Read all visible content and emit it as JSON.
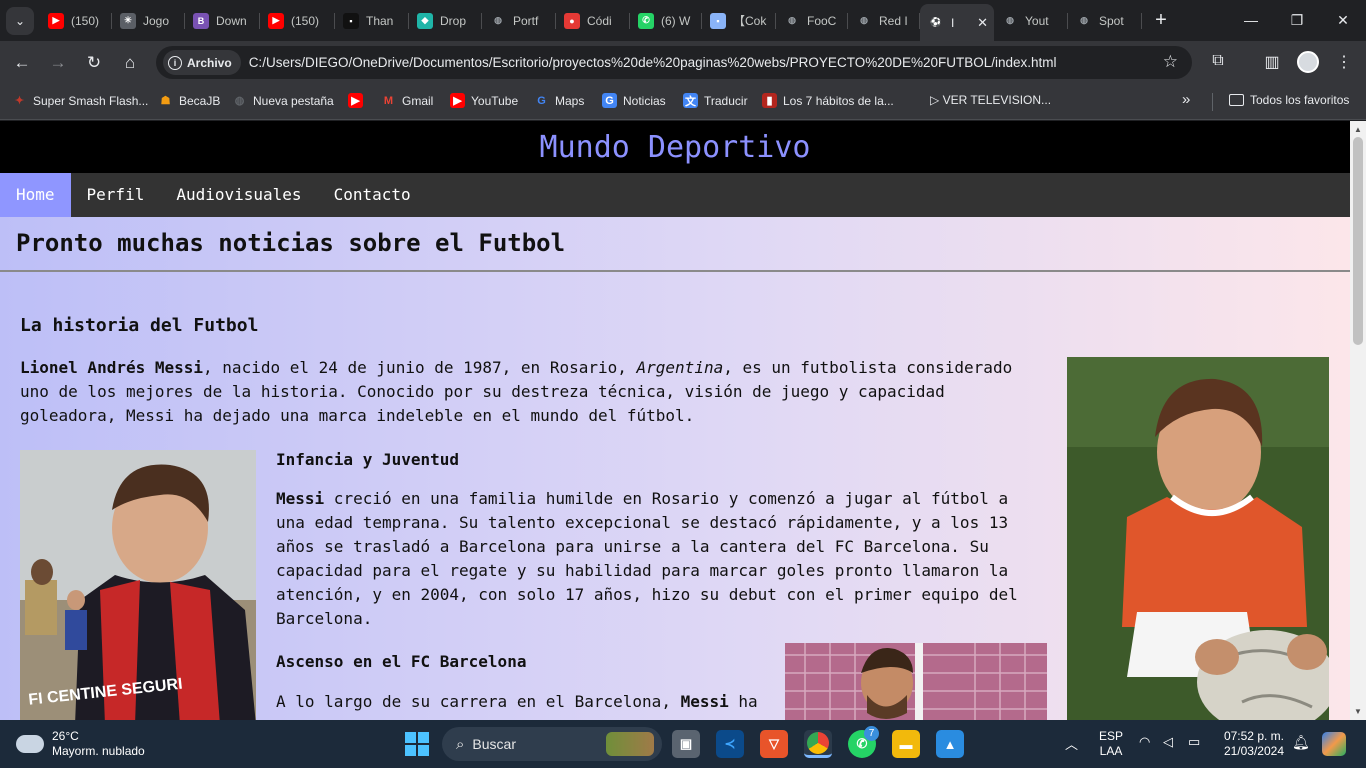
{
  "browser": {
    "tabs": [
      {
        "label": "(150)",
        "icon": "youtube-icon",
        "color": "#ff0000"
      },
      {
        "label": "Jogo",
        "icon": "chatgpt-icon",
        "color": "#5b5f66"
      },
      {
        "label": "Down",
        "icon": "bootstrap-icon",
        "color": "#7952b3"
      },
      {
        "label": "(150)",
        "icon": "youtube-icon",
        "color": "#ff0000"
      },
      {
        "label": "Than",
        "icon": "page-icon",
        "color": "#111111"
      },
      {
        "label": "Drop",
        "icon": "drop-icon",
        "color": "#1fb5a8"
      },
      {
        "label": "Portf",
        "icon": "globe-icon",
        "color": "#5f6368"
      },
      {
        "label": "Códi",
        "icon": "record-icon",
        "color": "#e53935"
      },
      {
        "label": "(6) W",
        "icon": "whatsapp-icon",
        "color": "#25d366"
      },
      {
        "label": "【Cok",
        "icon": "page-icon",
        "color": "#8ab4f8"
      },
      {
        "label": "FooC",
        "icon": "globe-icon",
        "color": "#5f6368"
      },
      {
        "label": "Red I",
        "icon": "globe-icon",
        "color": "#5f6368"
      },
      {
        "label": "I",
        "icon": "football-icon",
        "color": "#e8eaed",
        "active": true
      },
      {
        "label": "Yout",
        "icon": "globe-icon",
        "color": "#5f6368"
      },
      {
        "label": "Spot",
        "icon": "globe-icon",
        "color": "#5f6368"
      }
    ],
    "new_tab_label": "+",
    "window_controls": [
      "—",
      "❐",
      "✕"
    ],
    "address": {
      "chip": "Archivo",
      "url": "C:/Users/DIEGO/OneDrive/Documentos/Escritorio/proyectos%20de%20paginas%20webs/PROYECTO%20DE%20FUTBOL/index.html"
    },
    "bookmarks": [
      {
        "label": "Super Smash Flash...",
        "icon": "smash-icon",
        "color": "#c0392b"
      },
      {
        "label": "BecaJB",
        "icon": "becajb-icon",
        "color": "#f39c12"
      },
      {
        "label": "Nueva pestaña",
        "icon": "globe-icon",
        "color": "#5f6368"
      },
      {
        "label": "",
        "icon": "youtube-icon",
        "color": "#ff0000"
      },
      {
        "label": "Gmail",
        "icon": "gmail-icon",
        "color": "#ea4335"
      },
      {
        "label": "YouTube",
        "icon": "youtube-icon",
        "color": "#ff0000"
      },
      {
        "label": "Maps",
        "icon": "google-icon",
        "color": "#4285f4"
      },
      {
        "label": "Noticias",
        "icon": "news-icon",
        "color": "#4285f4"
      },
      {
        "label": "Traducir",
        "icon": "translate-icon",
        "color": "#4285f4"
      },
      {
        "label": "Los 7 hábitos de la...",
        "icon": "pdf-icon",
        "color": "#b3261e"
      },
      {
        "label": "▷ VER TELEVISION...",
        "icon": "",
        "color": ""
      }
    ],
    "overflow_label": "»",
    "all_bookmarks": "Todos los favoritos"
  },
  "site": {
    "title": "Mundo Deportivo",
    "nav": [
      "Home",
      "Perfil",
      "Audiovisuales",
      "Contacto"
    ],
    "subheader": "Pronto muchas noticias sobre el Futbol",
    "section_title": "La historia del Futbol",
    "intro": {
      "name": "Lionel Andrés Messi",
      "text1": ", nacido el 24 de junio de 1987, en Rosario, ",
      "country": "Argentina",
      "text2": ", es un futbolista considerado uno de los mejores de la historia. Conocido por su destreza técnica, visión de juego y capacidad goleadora, Messi ha dejado una marca indeleble en el mundo del fútbol."
    },
    "childhood": {
      "heading": "Infancia y Juventud",
      "name": "Messi",
      "text": " creció en una familia humilde en Rosario y comenzó a jugar al fútbol a una edad temprana. Su talento excepcional se destacó rápidamente, y a los 13 años se trasladó a Barcelona para unirse a la cantera del FC Barcelona. Su capacidad para el regate y su habilidad para marcar goles pronto llamaron la atención, y en 2004, con solo 17 años, hizo su debut con el primer equipo del Barcelona."
    },
    "rise": {
      "heading": "Ascenso en el FC Barcelona",
      "text": "A lo largo de su carrera en el Barcelona, ",
      "name": "Messi",
      "text2": " ha"
    },
    "shirt_text": "FI CENTINE SEGURI"
  },
  "taskbar": {
    "weather_temp": "26°C",
    "weather_desc": "Mayorm. nublado",
    "search_placeholder": "Buscar",
    "whatsapp_badge": "7",
    "lang": "ESP",
    "lang2": "LAA",
    "time": "07:52 p. m.",
    "date": "21/03/2024"
  }
}
